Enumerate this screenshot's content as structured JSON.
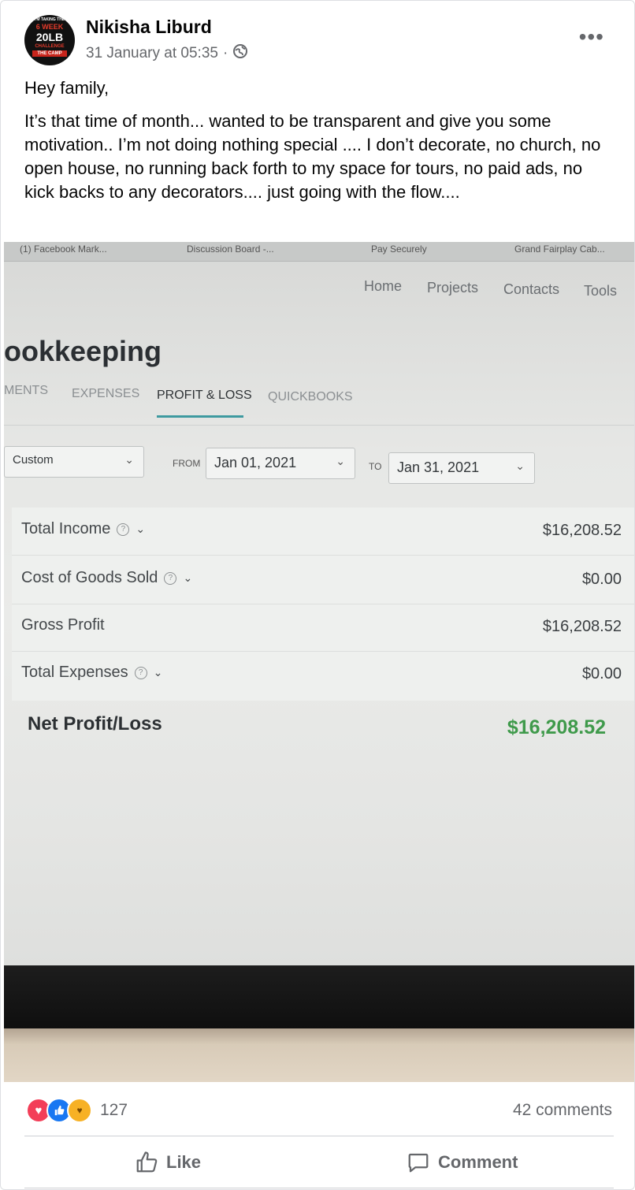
{
  "post": {
    "author": "Nikisha Liburd",
    "timestamp": "31 January at 05:35",
    "privacy_icon": "globe-icon",
    "avatar_text": [
      "I'M TAKING THE",
      "6 WEEK",
      "20LB",
      "CHALLENGE",
      "THE CAMP"
    ],
    "paragraphs": [
      "Hey family,",
      "It’s that time of month... wanted to be transparent and give you some motivation.. I’m not doing nothing special .... I don’t decorate, no church, no open house, no running back forth to my space for tours, no paid ads, no kick backs to any decorators.... just going with the flow...."
    ]
  },
  "photo": {
    "browser_tabs": [
      "(1) Facebook Mark...",
      "Discussion Board -...",
      "Pay Securely",
      "Grand Fairplay Cab..."
    ],
    "nav": [
      "Home",
      "Projects",
      "Contacts",
      "Tools"
    ],
    "page_title": "ookkeeping",
    "tabs": [
      "MENTS",
      "EXPENSES",
      "PROFIT & LOSS",
      "QUICKBOOKS"
    ],
    "active_tab": "PROFIT & LOSS",
    "period_select": "Custom",
    "from_label": "FROM",
    "from_value": "Jan 01, 2021",
    "to_label": "TO",
    "to_value": "Jan 31, 2021",
    "rows": [
      {
        "label": "Total Income",
        "value": "$16,208.52",
        "info": true
      },
      {
        "label": "Cost of Goods Sold",
        "value": "$0.00",
        "info": true
      },
      {
        "label": "Gross Profit",
        "value": "$16,208.52",
        "info": false
      },
      {
        "label": "Total Expenses",
        "value": "$0.00",
        "info": true
      }
    ],
    "net_label": "Net Profit/Loss",
    "net_value": "$16,208.52",
    "net_color": "#3f9a4b"
  },
  "footer": {
    "reaction_icons": [
      "love-icon",
      "like-icon",
      "care-icon"
    ],
    "reaction_count": "127",
    "comments": "42 comments",
    "like_label": "Like",
    "comment_label": "Comment"
  },
  "colors": {
    "facebook_blue": "#1877f2",
    "love_red": "#f33e58",
    "secondary_text": "#65676b"
  }
}
